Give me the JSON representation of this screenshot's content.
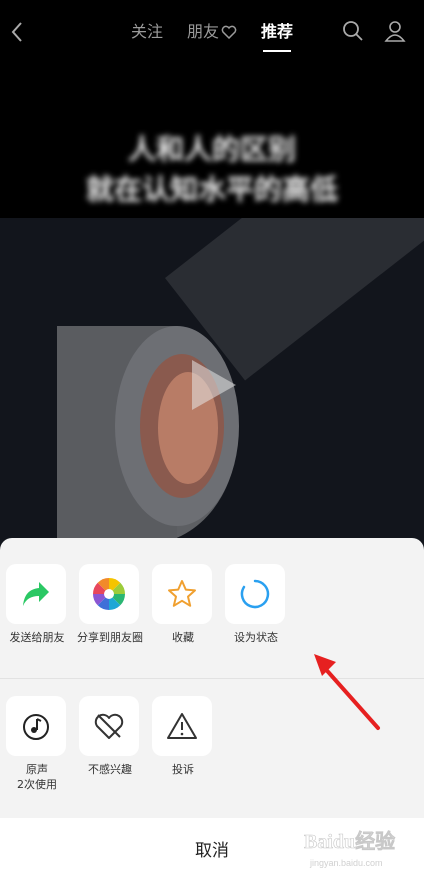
{
  "header": {
    "tabs": [
      {
        "label": "关注"
      },
      {
        "label": "朋友"
      },
      {
        "label": "推荐"
      }
    ],
    "active_tab": "推荐"
  },
  "video": {
    "caption_line1": "人和人的区别",
    "caption_line2": "就在认知水平的高低"
  },
  "share_sheet": {
    "row1": [
      {
        "label": "发送给朋友",
        "icon": "forward-arrow-icon",
        "color": "#2bc864"
      },
      {
        "label": "分享到朋友圈",
        "icon": "moments-aperture-icon",
        "color": "multicolor"
      },
      {
        "label": "收藏",
        "icon": "star-icon",
        "color": "#f0a030"
      },
      {
        "label": "设为状态",
        "icon": "status-ring-icon",
        "color": "#2aa0f0"
      }
    ],
    "row2": [
      {
        "label": "原声",
        "sublabel": "2次使用",
        "icon": "music-note-icon"
      },
      {
        "label": "不感兴趣",
        "icon": "broken-heart-icon"
      },
      {
        "label": "投诉",
        "icon": "warning-icon"
      }
    ],
    "cancel_label": "取消"
  },
  "annotation": {
    "arrow_color": "#e62020"
  },
  "watermark": {
    "text": "Baidu经验",
    "url": "jingyan.baidu.com"
  }
}
